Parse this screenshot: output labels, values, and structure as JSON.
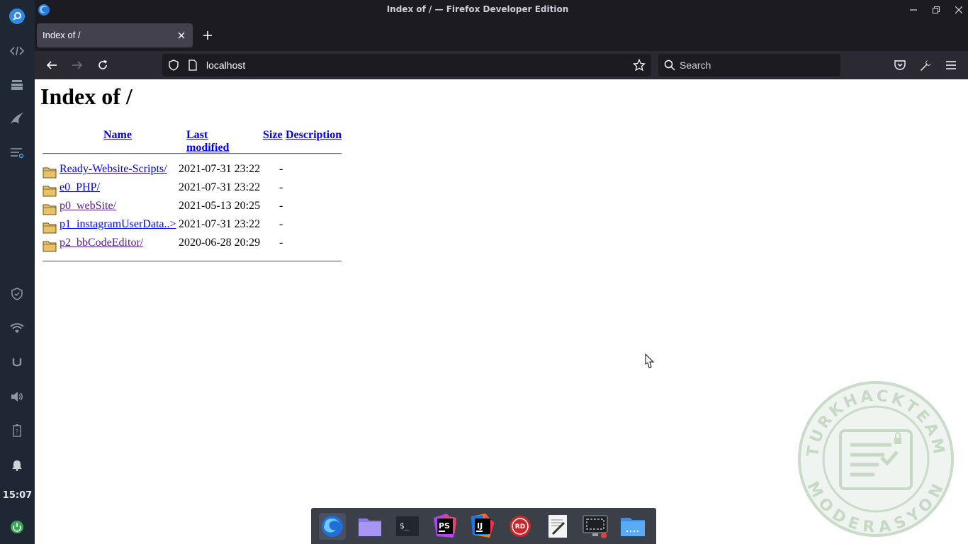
{
  "window": {
    "title": "Index of / — Firefox Developer Edition"
  },
  "tabs": [
    {
      "label": "Index of /"
    }
  ],
  "navbar": {
    "url": "localhost",
    "search_placeholder": "Search"
  },
  "panel": {
    "clock": "15:07"
  },
  "page": {
    "heading": "Index of /",
    "columns": [
      "Name",
      "Last modified",
      "Size",
      "Description"
    ],
    "rows": [
      {
        "name": "Ready-Website-Scripts/",
        "modified": "2021-07-31 23:22",
        "size": "-",
        "description": "",
        "visited": false
      },
      {
        "name": "e0_PHP/",
        "modified": "2021-07-31 23:22",
        "size": "-",
        "description": "",
        "visited": false
      },
      {
        "name": "p0_webSite/",
        "modified": "2021-05-13 20:25",
        "size": "-",
        "description": "",
        "visited": true
      },
      {
        "name": "p1_instagramUserData..>",
        "modified": "2021-07-31 23:22",
        "size": "-",
        "description": "",
        "visited": false
      },
      {
        "name": "p2_bbCodeEditor/",
        "modified": "2020-06-28 20:29",
        "size": "-",
        "description": "",
        "visited": true
      }
    ]
  },
  "dock": {
    "items": [
      "firefox-icon",
      "files-icon",
      "terminal-icon",
      "phpstorm-icon",
      "intellij-icon",
      "redis-desktop-icon",
      "text-editor-icon",
      "screenshot-icon",
      "folder-icon"
    ],
    "phpstorm_label": "PS",
    "intellij_label": "IJ",
    "redis_label": "RD",
    "terminal_label": "$_"
  },
  "watermark": {
    "top_text": "TURKHACKTEAM",
    "bottom_text": "MODERASYON"
  },
  "colors": {
    "panel_bg": "#1e2733",
    "browser_chrome": "#1c1b22",
    "toolbar": "#2b2a33",
    "link": "#0000ee",
    "visited_link": "#551a8b"
  }
}
